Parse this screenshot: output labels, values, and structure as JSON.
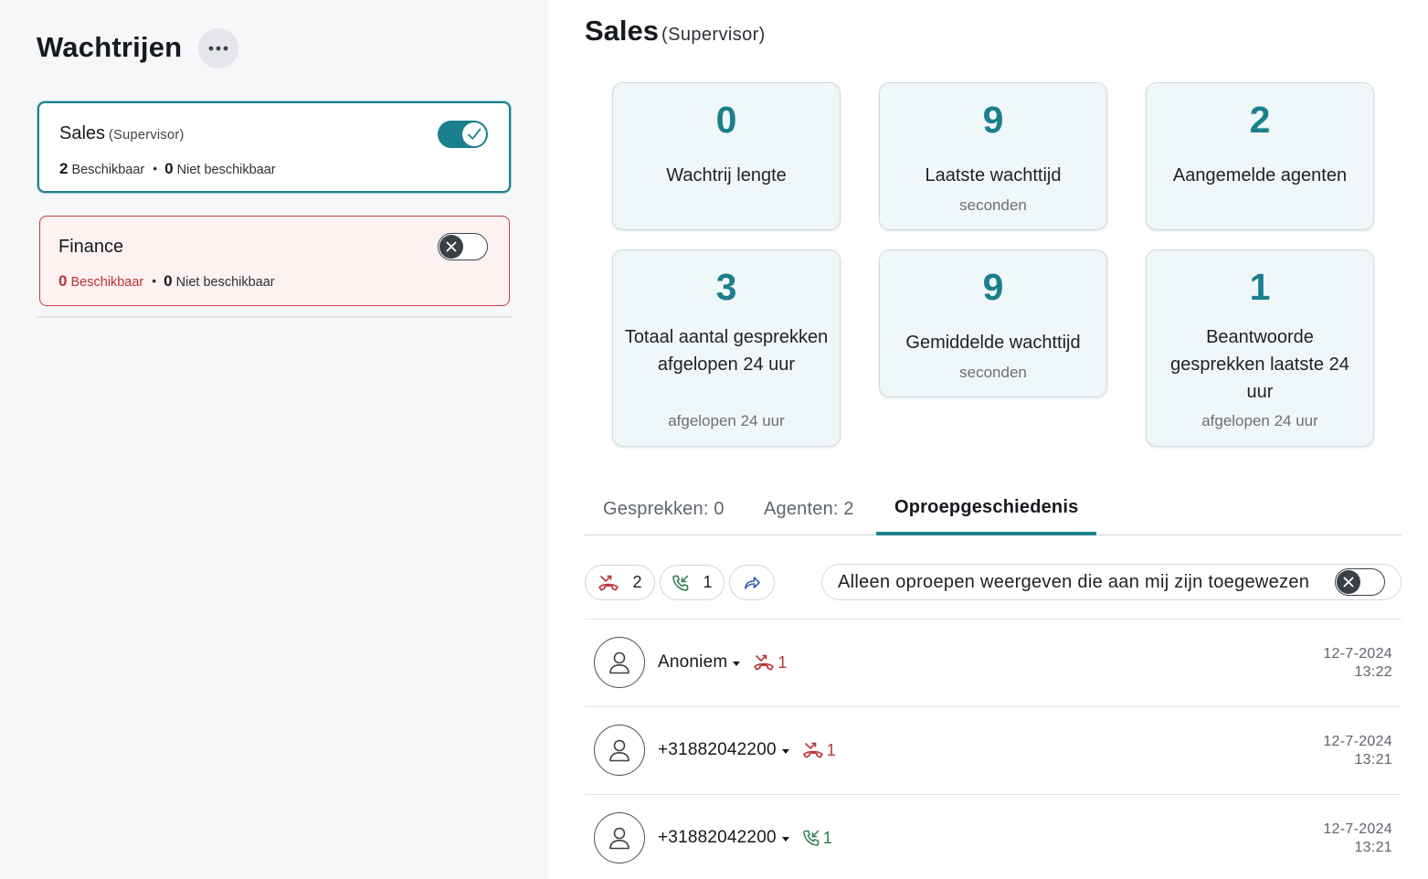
{
  "left": {
    "title": "Wachtrijen",
    "queues": [
      {
        "name": "Sales",
        "role": "(Supervisor)",
        "available_count": "2",
        "available_label": "Beschikbaar",
        "unavailable_count": "0",
        "unavailable_label": "Niet beschikbaar",
        "enabled": true
      },
      {
        "name": "Finance",
        "role": "",
        "available_count": "0",
        "available_label": "Beschikbaar",
        "unavailable_count": "0",
        "unavailable_label": "Niet beschikbaar",
        "enabled": false
      }
    ]
  },
  "main": {
    "title": "Sales",
    "role": "(Supervisor)",
    "stats": [
      {
        "value": "0",
        "label": "Wachtrij lengte",
        "sub": ""
      },
      {
        "value": "9",
        "label": "Laatste wachttijd",
        "sub": "seconden"
      },
      {
        "value": "2",
        "label": "Aangemelde agenten",
        "sub": ""
      },
      {
        "value": "3",
        "label": "Totaal aantal gesprekken afgelopen 24 uur",
        "sub": "afgelopen 24 uur"
      },
      {
        "value": "9",
        "label": "Gemiddelde wachttijd",
        "sub": "seconden"
      },
      {
        "value": "1",
        "label": "Beantwoorde gesprekken laatste 24 uur",
        "sub": "afgelopen 24 uur"
      }
    ],
    "tabs": [
      {
        "label": "Gesprekken: 0",
        "active": false
      },
      {
        "label": "Agenten: 2",
        "active": false
      },
      {
        "label": "Oproepgeschiedenis",
        "active": true
      }
    ],
    "filters": {
      "missed_count": "2",
      "answered_count": "1",
      "assigned_only_label": "Alleen oproepen weergeven die aan mij zijn toegewezen",
      "assigned_only_enabled": false
    },
    "history": [
      {
        "caller": "Anoniem",
        "type": "missed",
        "count": "1",
        "date": "12-7-2024",
        "time": "13:22"
      },
      {
        "caller": "+31882042200",
        "type": "missed",
        "count": "1",
        "date": "12-7-2024",
        "time": "13:21"
      },
      {
        "caller": "+31882042200",
        "type": "answered",
        "count": "1",
        "date": "12-7-2024",
        "time": "13:21"
      }
    ]
  },
  "icons": {
    "more": "more-horizontal-icon",
    "toggle_on": "check-icon",
    "toggle_off": "x-icon",
    "missed": "missed-call-icon",
    "answered": "incoming-call-icon",
    "forwarded": "forward-icon",
    "avatar": "user-icon"
  },
  "colors": {
    "accent": "#1b7f8d",
    "missed": "#b93535",
    "answered": "#2e7d4f",
    "forward": "#2f5fb3"
  }
}
